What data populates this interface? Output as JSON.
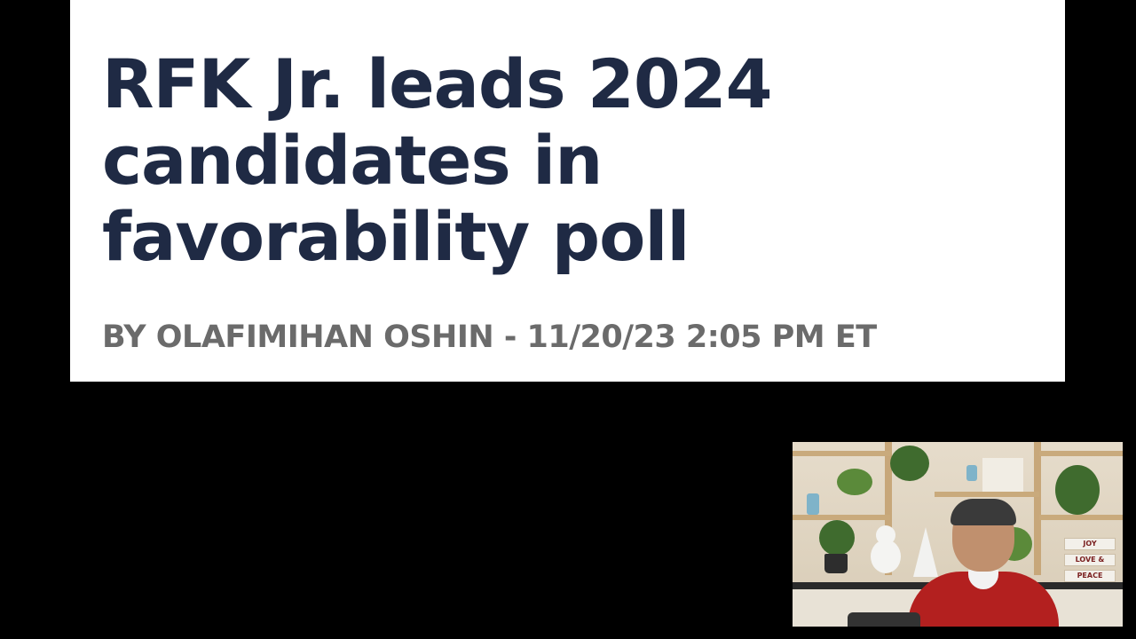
{
  "article": {
    "headline": "RFK Jr. leads 2024 candidates in favorability poll",
    "byline": "BY OLAFIMIHAN OSHIN - 11/20/23 2:05 PM ET"
  },
  "webcam": {
    "signs": [
      "JOY",
      "LOVE &",
      "PEACE"
    ]
  },
  "colors": {
    "background": "#000000",
    "card": "#ffffff",
    "headline": "#1f2a44",
    "byline": "#6b6b6b"
  }
}
